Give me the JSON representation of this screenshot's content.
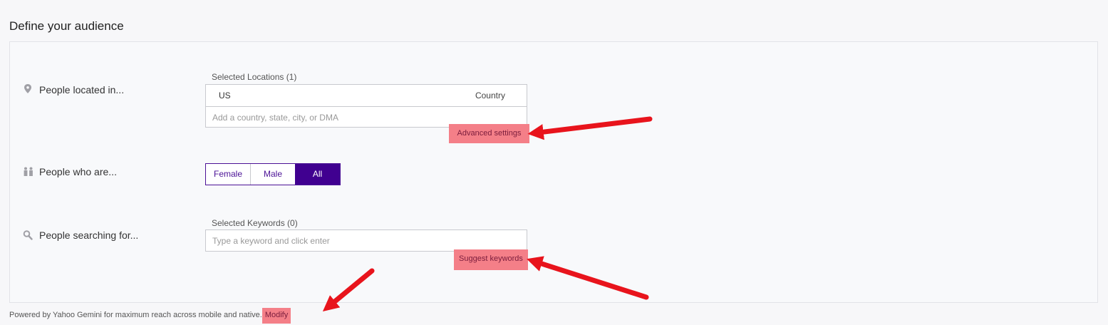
{
  "section": {
    "title": "Define your audience"
  },
  "location": {
    "label": "People located in...",
    "icon": "location-pin-icon",
    "selected_label": "Selected Locations (1)",
    "entries": [
      {
        "value": "US",
        "type": "Country"
      }
    ],
    "placeholder": "Add a country, state, city, or DMA",
    "advanced_link": "Advanced settings"
  },
  "gender": {
    "label": "People who are...",
    "icon": "people-icon",
    "options": [
      "Female",
      "Male",
      "All"
    ],
    "selected": "All"
  },
  "keywords": {
    "label": "People searching for...",
    "icon": "search-icon",
    "selected_label": "Selected Keywords (0)",
    "placeholder": "Type a keyword and click enter",
    "suggest_link": "Suggest keywords"
  },
  "footer": {
    "text": "Powered by Yahoo Gemini for maximum reach across mobile and native.",
    "modify_link": "Modify"
  },
  "colors": {
    "accent": "#400090",
    "highlight": "#f47f88",
    "annotation_arrow": "#e8141c"
  }
}
